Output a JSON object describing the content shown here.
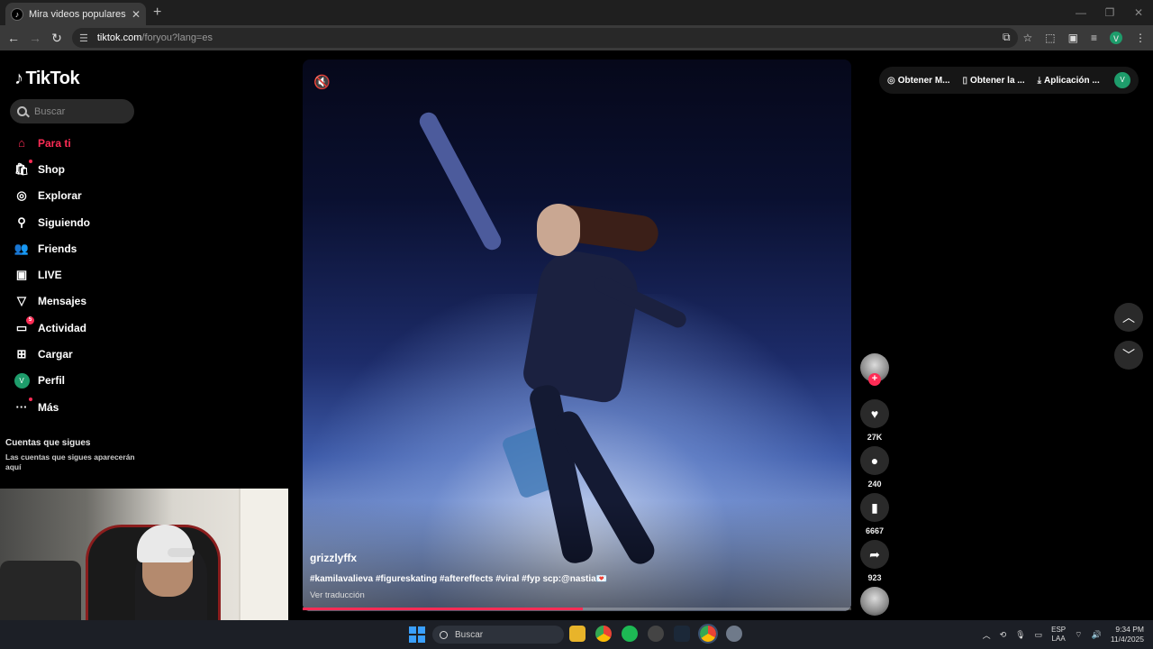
{
  "browser": {
    "tab_title": "Mira videos populares seleccionados",
    "tab_close": "✕",
    "new_tab": "+",
    "url_host": "tiktok.com",
    "url_path": "/foryou?lang=es",
    "profile_initial": "v"
  },
  "sidebar": {
    "logo_text": "TikTok",
    "search_placeholder": "Buscar",
    "items": [
      {
        "label": "Para ti",
        "icon": "home-icon",
        "active": true
      },
      {
        "label": "Shop",
        "icon": "shop-icon"
      },
      {
        "label": "Explorar",
        "icon": "compass-icon"
      },
      {
        "label": "Siguiendo",
        "icon": "following-icon"
      },
      {
        "label": "Friends",
        "icon": "friends-icon"
      },
      {
        "label": "LIVE",
        "icon": "live-icon"
      },
      {
        "label": "Mensajes",
        "icon": "messages-icon"
      },
      {
        "label": "Actividad",
        "icon": "activity-icon",
        "badge": "5"
      },
      {
        "label": "Cargar",
        "icon": "upload-icon"
      },
      {
        "label": "Perfil",
        "icon": "profile-icon",
        "avatar": "V"
      },
      {
        "label": "Más",
        "icon": "more-icon"
      }
    ],
    "following_title": "Cuentas que sigues",
    "following_sub": "Las cuentas que sigues aparecerán aquí"
  },
  "video": {
    "username": "grizzlyffx",
    "description": "#kamilavalieva #figureskating #aftereffects #viral #fyp scp:@nastia💌",
    "translate": "Ver traducción",
    "progress": 0.51
  },
  "actions": {
    "likes": "27K",
    "comments": "240",
    "saves": "6667",
    "shares": "923"
  },
  "topbar": {
    "item1": "Obtener M...",
    "item2": "Obtener la ...",
    "item3": "Aplicación ...",
    "avatar": "V"
  },
  "taskbar": {
    "search_placeholder": "Buscar",
    "lang_line1": "ESP",
    "lang_line2": "LAA",
    "time": "9:34 PM",
    "date": "11/4/2025"
  },
  "colors": {
    "accent": "#fe2c55",
    "background": "#000000",
    "avatar_green": "#1e9c6b"
  }
}
